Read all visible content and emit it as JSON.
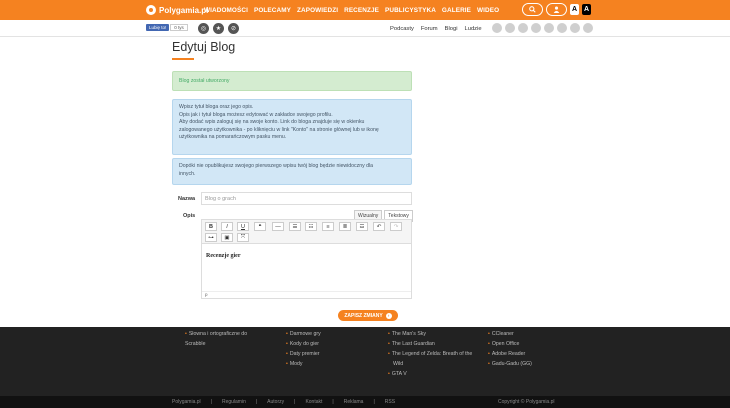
{
  "topbar": {
    "logo_text": "Polygamia.pl",
    "nav": [
      "WIADOMOŚCI",
      "POLECAMY",
      "ZAPOWIEDZI",
      "RECENZJE",
      "PUBLICYSTYKA",
      "GALERIE",
      "WIDEO"
    ],
    "contrast_a_light": "A",
    "contrast_a_dark": "A"
  },
  "subbar": {
    "fb_like": "Lubię to!",
    "fb_count": "0 tys",
    "links": [
      "Podcasty",
      "Forum",
      "Blogi",
      "Ludzie"
    ]
  },
  "page": {
    "title": "Edytuj Blog",
    "alert_success": "Blog został utworzony",
    "alert_info_lines": [
      "Wpisz tytuł bloga oraz jego opis.",
      "Opis jak i tytuł bloga możesz edytować w zakładce swojego profilu.",
      "Aby dodać wpis zaloguj się na swoje konto. Link do bloga znajduje się w okienku",
      "zalogowanego użytkownika - po kliknięciu w link \"Konto\" na stronie głównej lub w ikonę",
      "użytkownika na pomarańczowym pasku menu."
    ],
    "alert_note_lines": [
      "Dopóki nie opublikujesz swojego pierwszego wpisu twój blog będzie niewidoczny dla",
      "innych."
    ],
    "name_label": "Nazwa",
    "name_value": "Blog o grach",
    "opis_label": "Opis",
    "tab_visual": "Wizualny",
    "tab_text": "Tekstowy",
    "editor_text": "Recenzje gier",
    "editor_status": "p",
    "save_label": "ZAPISZ ZMIANY",
    "save_arrow": "›"
  },
  "footer": {
    "col1": [
      "Słowna i ortograficzne do",
      "Scrabble"
    ],
    "col2": [
      "Darmowe gry",
      "Kody do gier",
      "Daty premier",
      "Mody"
    ],
    "col3": [
      "The Man's Sky",
      "The Last Guardian",
      "The Legend of Zelda: Breath of the",
      "Wild",
      "GTA V"
    ],
    "col4": [
      "CCleaner",
      "Open Office",
      "Adobe Reader",
      "Gadu-Gadu (GG)"
    ],
    "bottom_links": [
      "Polygamia.pl",
      "|",
      "Regulamin",
      "|",
      "Autorzy",
      "|",
      "Kontakt",
      "|",
      "Reklama",
      "|",
      "RSS"
    ],
    "copyright": "Copyright © Polygamia.pl"
  },
  "colors": {
    "accent": "#f58220",
    "footer": "#222222"
  }
}
